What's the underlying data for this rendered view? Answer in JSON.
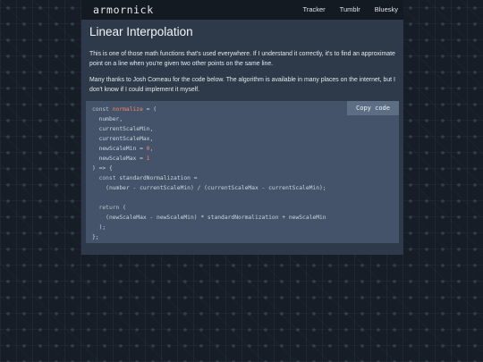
{
  "site": {
    "brand": "armornick"
  },
  "nav": {
    "items": [
      {
        "label": "Tracker"
      },
      {
        "label": "Tumblr"
      },
      {
        "label": "Bluesky"
      }
    ]
  },
  "article": {
    "title": "Linear Interpolation",
    "para1": "This is one of those math functions that's used everywhere. If I understand it correctly, it's to find an approximate point on a line when you're given two other points on the same line.",
    "para2": "Many thanks to Josh Comeau for the code below. The algorithm is available in many places on the internet, but I don't know if I could implement it myself."
  },
  "code": {
    "copy_label": "Copy code",
    "line1_kw": "const",
    "line1_name": "normalize",
    "line1_rest": " = (",
    "line2": "  number,",
    "line3": "  currentScaleMin,",
    "line4": "  currentScaleMax,",
    "line5_pre": "  newScaleMin = ",
    "line5_num": "0",
    "line5_post": ",",
    "line6_pre": "  newScaleMax = ",
    "line6_num": "1",
    "line7": ") => {",
    "line8_kw": "  const",
    "line8_rest": " standardNormalization =",
    "line9": "    (number - currentScaleMin) / (currentScaleMax - currentScaleMin);",
    "line11_kw": "  return",
    "line11_rest": " (",
    "line12": "    (newScaleMax - newScaleMin) * standardNormalization + newScaleMin",
    "line13": "  );",
    "line14": "};"
  }
}
